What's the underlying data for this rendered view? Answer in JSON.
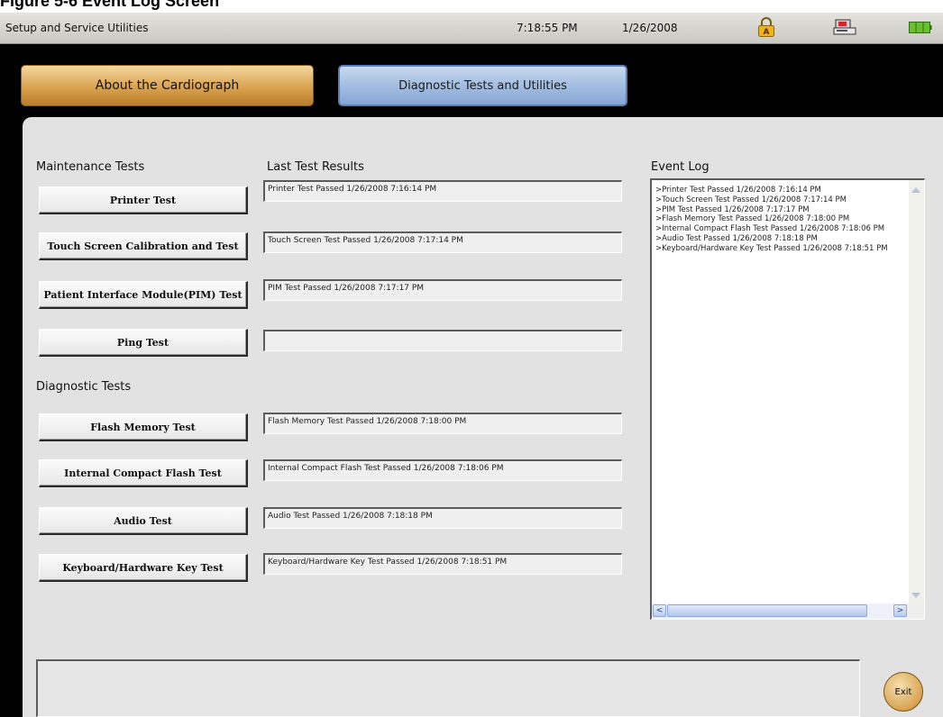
{
  "caption": "Figure 5-6    Event Log Screen",
  "statusbar": {
    "title": "Setup and Service Utilities",
    "time": "7:18:55 PM",
    "date": "1/26/2008",
    "icons": [
      "lock-icon",
      "device-icon",
      "battery-icon"
    ]
  },
  "tabs": {
    "about": "About the Cardiograph",
    "diagnostic": "Diagnostic Tests and Utilities"
  },
  "headings": {
    "maintenance": "Maintenance Tests",
    "results": "Last Test Results",
    "diagnostic": "Diagnostic Tests",
    "event_log": "Event Log"
  },
  "maintenance_tests": [
    {
      "label": "Printer Test",
      "result": "Printer Test Passed 1/26/2008 7:16:14 PM"
    },
    {
      "label": "Touch Screen Calibration and Test",
      "result": "Touch Screen Test Passed 1/26/2008 7:17:14 PM"
    },
    {
      "label": "Patient Interface Module(PIM) Test",
      "result": "PIM Test Passed 1/26/2008 7:17:17 PM"
    },
    {
      "label": "Ping Test",
      "result": ""
    }
  ],
  "diagnostic_tests": [
    {
      "label": "Flash Memory Test",
      "result": "Flash Memory Test Passed 1/26/2008 7:18:00 PM"
    },
    {
      "label": "Internal Compact Flash Test",
      "result": "Internal Compact Flash Test Passed 1/26/2008 7:18:06 PM"
    },
    {
      "label": "Audio Test",
      "result": "Audio Test Passed 1/26/2008 7:18:18 PM"
    },
    {
      "label": "Keyboard/Hardware Key Test",
      "result": "Keyboard/Hardware Key Test Passed 1/26/2008 7:18:51 PM"
    }
  ],
  "event_log": [
    ">Printer Test Passed 1/26/2008 7:16:14 PM",
    ">Touch Screen Test Passed 1/26/2008 7:17:14 PM",
    ">PIM Test Passed 1/26/2008 7:17:17 PM",
    ">Flash Memory Test Passed 1/26/2008 7:18:00 PM",
    ">Internal Compact Flash Test Passed 1/26/2008 7:18:06 PM",
    ">Audio Test Passed 1/26/2008 7:18:18 PM",
    ">Keyboard/Hardware Key Test Passed 1/26/2008 7:18:51 PM"
  ],
  "message_box": "",
  "exit_label": "Exit",
  "colors": {
    "about_tab": "#d9a24e",
    "diagnostic_tab": "#9fbbe0",
    "panel": "#e2e2e2",
    "battery": "#69c02e"
  }
}
